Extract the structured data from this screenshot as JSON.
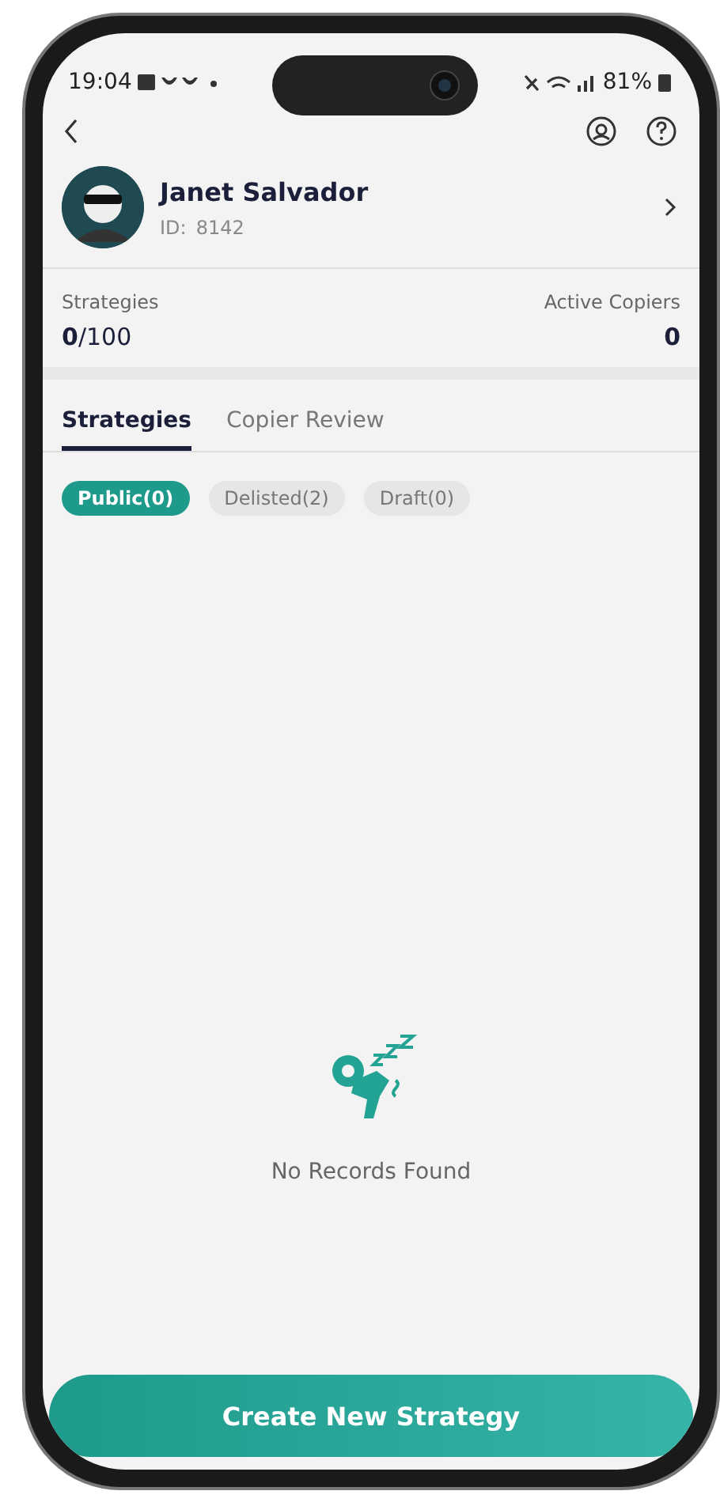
{
  "status_bar": {
    "time": "19:04",
    "battery": "81%"
  },
  "profile": {
    "name": "Janet Salvador",
    "id_label": "ID:",
    "id_value": "8142"
  },
  "stats": [
    {
      "label": "Strategies",
      "value": "**0**/100"
    },
    {
      "label": "Active Copiers",
      "value": "0"
    }
  ],
  "tabs": [
    {
      "label": "Strategies",
      "selected": true
    },
    {
      "label": "Copier Review",
      "selected": false
    }
  ],
  "filters": [
    {
      "label": "Public(0)",
      "selected": true
    },
    {
      "label": "Delisted(2)",
      "selected": false
    },
    {
      "label": "Draft(0)",
      "selected": false
    }
  ],
  "empty_state": {
    "message": "No Records Found"
  },
  "primary_button": {
    "label": "Create New Strategy"
  }
}
